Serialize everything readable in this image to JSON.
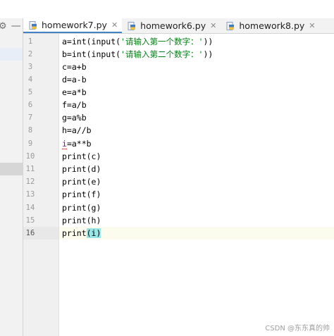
{
  "tabs": [
    {
      "label": "homework7.py",
      "active": true
    },
    {
      "label": "homework6.py",
      "active": false
    },
    {
      "label": "homework8.py",
      "active": false
    }
  ],
  "editor": {
    "line_numbers": [
      "1",
      "2",
      "3",
      "4",
      "5",
      "6",
      "7",
      "8",
      "9",
      "10",
      "11",
      "12",
      "13",
      "14",
      "15",
      "16"
    ],
    "current_line": 16,
    "lines": [
      [
        "a=int(input(",
        "'请输入第一个数字：'",
        "))"
      ],
      [
        "b=int(input(",
        "'请输入第二个数字：'",
        "))"
      ],
      [
        "c=a+b"
      ],
      [
        "d=a-b"
      ],
      [
        "e=a*b"
      ],
      [
        "f=a/b"
      ],
      [
        "g=a%b"
      ],
      [
        "h=a//b"
      ],
      [
        "i",
        "=a**b"
      ],
      [
        "print(c)"
      ],
      [
        "print(d)"
      ],
      [
        "print(e)"
      ],
      [
        "print(f)"
      ],
      [
        "print(g)"
      ],
      [
        "print(h)"
      ],
      [
        "print",
        "(i)"
      ]
    ]
  },
  "watermark": "CSDN @东东真的帅",
  "colors": {
    "accent": "#4083c9",
    "string": "#067d17",
    "highlight": "#99e6e6"
  }
}
